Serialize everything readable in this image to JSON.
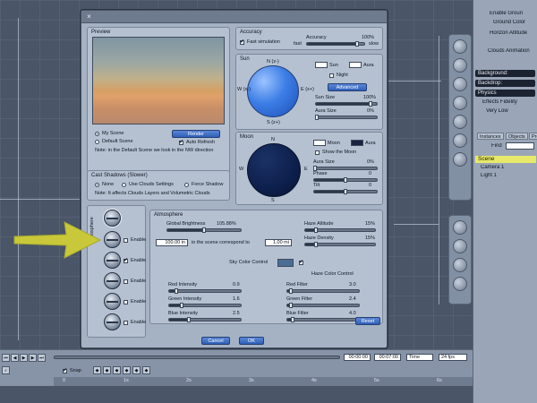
{
  "preview": {
    "title": "Preview",
    "my_scene": "My Scene",
    "default_scene": "Default Scene",
    "render_button": "Render",
    "auto_refresh": "Auto Refresh",
    "note": "Note: in the Default Scene we look in the NW direction"
  },
  "cast_shadows": {
    "title": "Cast Shadows (Slower)",
    "none": "None",
    "use_clouds": "Use Clouds Settings",
    "force_shadow": "Force Shadow",
    "note": "Note: It affects Clouds Layers and Volumetric Clouds"
  },
  "accuracy": {
    "title": "Accuracy",
    "fast_simulation": "Fast simulation",
    "accuracy_label": "Accuracy",
    "accuracy_value": "100%",
    "accuracy_level": 0.88,
    "fast": "fast",
    "slow": "slow"
  },
  "sun": {
    "title": "Sun",
    "north": "N (z-)",
    "west": "W (x-)",
    "east": "E (x+)",
    "south": "S (z+)",
    "sun_label": "Sun",
    "aura_label": "Aura",
    "night": "Night",
    "advanced_button": "Advanced",
    "sun_size": "Sun Size",
    "sun_size_value": "100%",
    "sun_size_level": 0.9,
    "aura_size": "Aura Size",
    "aura_size_value": "0%",
    "aura_size_level": 0.02
  },
  "moon": {
    "title": "Moon",
    "north": "N",
    "west": "W",
    "east": "E",
    "south": "S",
    "moon_label": "Moon",
    "aura_label": "Aura",
    "show_moon": "Show the Moon",
    "aura_size": "Aura Size",
    "aura_size_value": "0%",
    "aura_size_level": 0.02,
    "phase": "Phase",
    "phase_value": "0",
    "phase_level": 0.5,
    "tilt": "Tilt",
    "tilt_value": "0",
    "tilt_level": 0.5
  },
  "atmosphere_tab": {
    "vertical_label": "Atmosphere",
    "enable": "Enable"
  },
  "atmosphere": {
    "title": "Atmosphere",
    "global_brightness": "Global Brightness",
    "global_brightness_value": "105.88%",
    "global_brightness_level": 0.5,
    "haze_altitude": "Haze Altitude",
    "haze_altitude_value": "15%",
    "haze_altitude_level": 0.15,
    "scale_left_value": "100.00 in",
    "scale_text": "in the scene correspond to",
    "scale_right_value": "1.00 mi",
    "haze_density": "Haze Density",
    "haze_density_value": "15%",
    "haze_density_level": 0.15,
    "sky_color_control": "Sky Color Control",
    "haze_color_control": "Haze Color Control",
    "red_intensity": "Red Intensity",
    "red_intensity_value": "0.9",
    "red_intensity_level": 0.1,
    "green_intensity": "Green Intensity",
    "green_intensity_value": "1.6",
    "green_intensity_level": 0.18,
    "blue_intensity": "Blue Intensity",
    "blue_intensity_value": "2.5",
    "blue_intensity_level": 0.28,
    "red_filter": "Red Filter",
    "red_filter_value": "3.0",
    "red_filter_level": 0.05,
    "green_filter": "Green Filter",
    "green_filter_value": "2.4",
    "green_filter_level": 0.05,
    "blue_filter": "Blue Filter",
    "blue_filter_value": "4.0",
    "blue_filter_level": 0.08,
    "reset_button": "Reset"
  },
  "footer": {
    "cancel_button": "Cancel",
    "ok_button": "OK"
  },
  "right_panel": {
    "enable_ground": "Enable Groun",
    "ground_color": "Ground Color",
    "horizon_altitude": "Horizon Altitude",
    "clouds_animation": "Clouds Animation",
    "background": "Background:",
    "backdrop": "Backdrop:",
    "physics": "Physics",
    "effects_fidelity": "Effects Fidelity",
    "very_low": "Very Low",
    "tab_instances": "Instances",
    "tab_objects": "Objects",
    "tab_presets": "Pre",
    "find": "Find",
    "scene": "Scene",
    "camera": "Camera 1",
    "light": "Light 1"
  },
  "timeline": {
    "snap": "Snap",
    "time_start": "00:00:00",
    "time_end": "00:07:00",
    "time_mode": "Time",
    "fps": "24 fps",
    "marks": [
      "0",
      "1s",
      "2s",
      "3s",
      "4s",
      "5s",
      "6s"
    ]
  },
  "colors": {
    "sun_color": "#ffffff",
    "sun_aura": "#ffffff",
    "moon_color": "#ffffff",
    "moon_aura": "#1a2240",
    "sky_color": "#4a6d96",
    "arrow": "#c8c83a",
    "sun_globe": "#3d7ee6",
    "moon_globe": "#0d1f4c"
  }
}
